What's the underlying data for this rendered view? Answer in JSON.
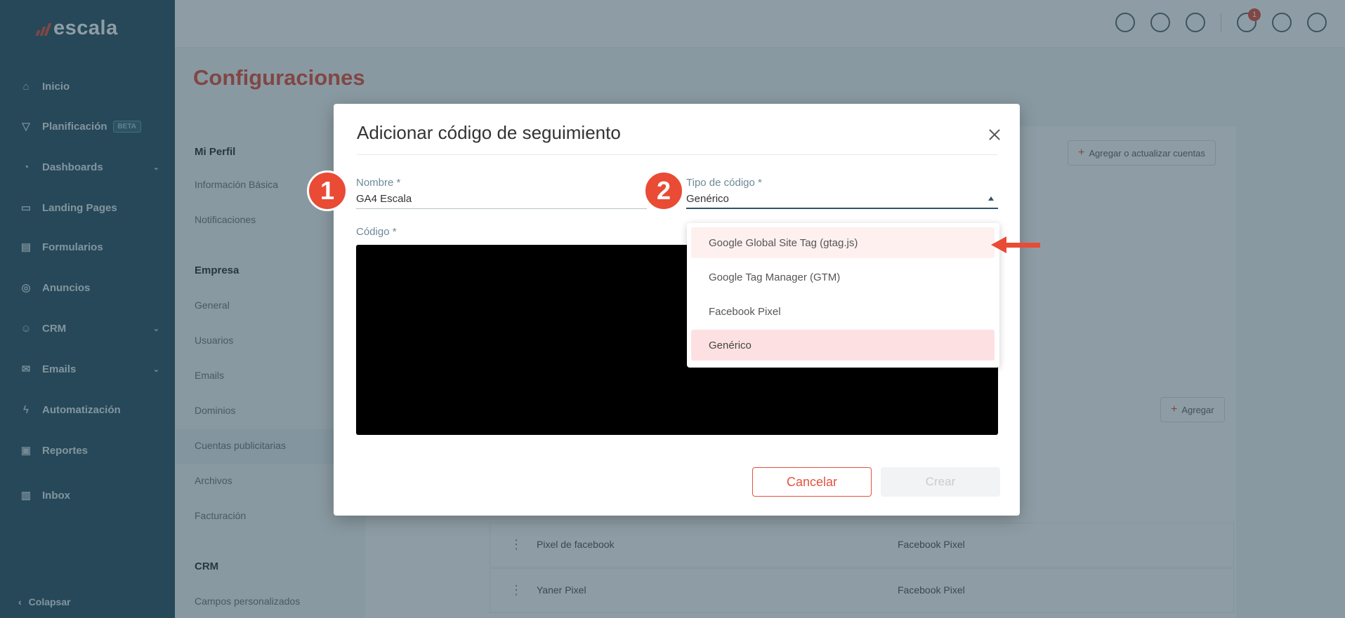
{
  "brand": {
    "name": "escala"
  },
  "sidebar": {
    "items": [
      {
        "label": "Inicio",
        "icon": "home-icon"
      },
      {
        "label": "Planificación",
        "icon": "funnel-icon",
        "badge": "BETA"
      },
      {
        "label": "Dashboards",
        "icon": "chart-icon",
        "has_children": true
      },
      {
        "label": "Landing Pages",
        "icon": "page-icon"
      },
      {
        "label": "Formularios",
        "icon": "form-icon"
      },
      {
        "label": "Anuncios",
        "icon": "megaphone-icon"
      },
      {
        "label": "CRM",
        "icon": "users-icon",
        "has_children": true
      },
      {
        "label": "Emails",
        "icon": "mail-icon",
        "has_children": true
      },
      {
        "label": "Automatización",
        "icon": "bolt-icon"
      },
      {
        "label": "Reportes",
        "icon": "report-icon"
      },
      {
        "label": "Inbox",
        "icon": "inbox-icon"
      }
    ],
    "collapse_label": "Colapsar"
  },
  "topbar": {
    "icons": [
      "chat-icon",
      "bell-icon",
      "plus-circle-icon",
      "cloud-icon",
      "gear-icon",
      "avatar-icon"
    ],
    "notification_count": "1"
  },
  "page": {
    "title": "Configuraciones",
    "settings_nav": {
      "sections": [
        {
          "heading": "Mi Perfil",
          "items": [
            "Información Básica",
            "Notificaciones"
          ]
        },
        {
          "heading": "Empresa",
          "items": [
            "General",
            "Usuarios",
            "Emails",
            "Dominios",
            "Cuentas publicitarias",
            "Archivos",
            "Facturación"
          ]
        },
        {
          "heading": "CRM",
          "items": [
            "Campos personalizados"
          ]
        }
      ],
      "active_item": "Cuentas publicitarias"
    },
    "buttons": {
      "add_update_accounts": "Agregar o actualizar cuentas",
      "add": "Agregar"
    },
    "table_rows": [
      {
        "name": "Pixel de facebook",
        "type": "Facebook Pixel"
      },
      {
        "name": "Yaner Pixel",
        "type": "Facebook Pixel"
      }
    ]
  },
  "modal": {
    "title": "Adicionar código de seguimiento",
    "name_field": {
      "label": "Nombre *",
      "value": "GA4 Escala"
    },
    "type_field": {
      "label": "Tipo de código *",
      "value": "Genérico"
    },
    "code_field": {
      "label": "Código *"
    },
    "dropdown_options": [
      "Google Global Site Tag (gtag.js)",
      "Google Tag Manager (GTM)",
      "Facebook Pixel",
      "Genérico"
    ],
    "cancel_label": "Cancelar",
    "create_label": "Crear"
  },
  "annotations": {
    "step1": "1",
    "step2": "2"
  },
  "colors": {
    "accent": "#e3533f",
    "sidebar": "#2f5566",
    "selected_option": "#fde1e2"
  }
}
